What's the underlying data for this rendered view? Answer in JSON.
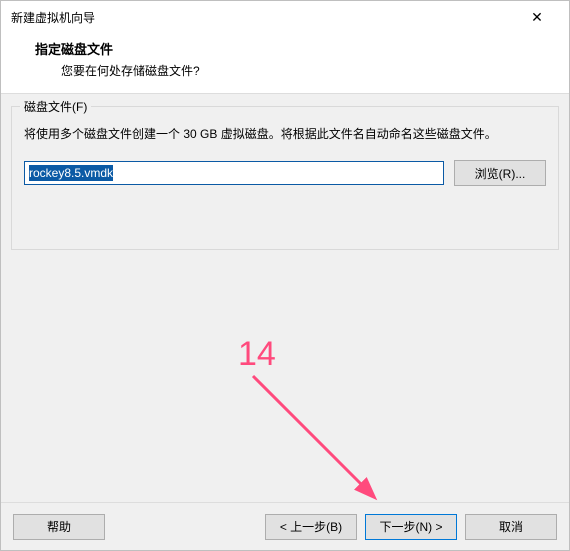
{
  "window": {
    "title": "新建虚拟机向导"
  },
  "header": {
    "heading": "指定磁盘文件",
    "sub": "您要在何处存储磁盘文件?"
  },
  "group": {
    "title": "磁盘文件(F)",
    "desc": "将使用多个磁盘文件创建一个 30 GB 虚拟磁盘。将根据此文件名自动命名这些磁盘文件。",
    "path_value": "rockey8.5.vmdk",
    "browse_label": "浏览(R)..."
  },
  "footer": {
    "help": "帮助",
    "back": "< 上一步(B)",
    "next": "下一步(N) >",
    "cancel": "取消"
  },
  "annotation": {
    "num": "14"
  },
  "colors": {
    "selection": "#0b5aa5",
    "default_border": "#0078d7",
    "arrow": "#ff4a7d"
  }
}
